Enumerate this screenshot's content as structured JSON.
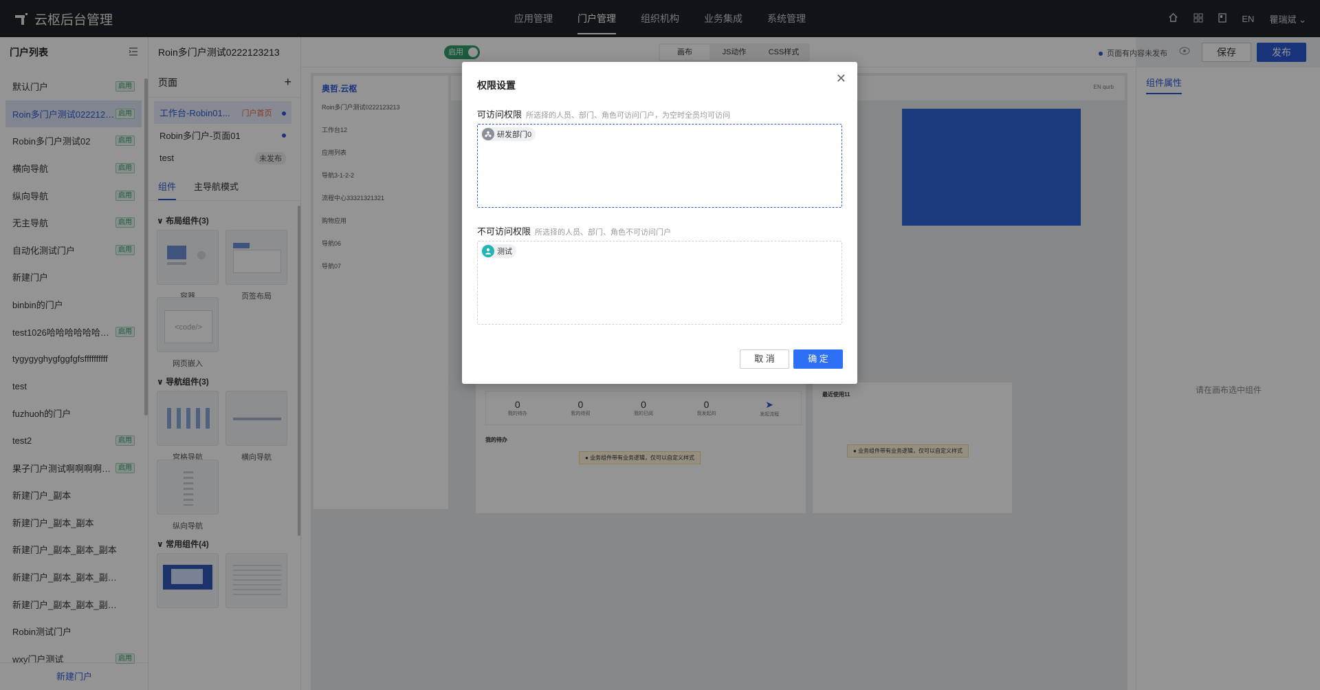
{
  "topbar": {
    "brand": "云枢后台管理",
    "nav": [
      "应用管理",
      "门户管理",
      "组织机构",
      "业务集成",
      "系统管理"
    ],
    "nav_active": 1,
    "lang": "EN",
    "user": "瞿瑞斌"
  },
  "sidebar": {
    "title": "门户列表",
    "items": [
      {
        "label": "默认门户",
        "badge": "启用"
      },
      {
        "label": "Roin多门户测试0222123213",
        "badge": "启用",
        "active": true
      },
      {
        "label": "Robin多门户测试02",
        "badge": "启用"
      },
      {
        "label": "横向导航",
        "badge": "启用"
      },
      {
        "label": "纵向导航",
        "badge": "启用"
      },
      {
        "label": "无主导航",
        "badge": "启用"
      },
      {
        "label": "自动化测试门户",
        "badge": "启用"
      },
      {
        "label": "新建门户",
        "badge": ""
      },
      {
        "label": "binbin的门户",
        "badge": ""
      },
      {
        "label": "test1026哈哈哈哈哈哈哈哈哈哈",
        "badge": "启用"
      },
      {
        "label": "tygygyghygfggfgfsffffffffff",
        "badge": ""
      },
      {
        "label": "test",
        "badge": ""
      },
      {
        "label": "fuzhuoh的门户",
        "badge": ""
      },
      {
        "label": "test2",
        "badge": "启用"
      },
      {
        "label": "果子门户测试啊啊啊啊啊啊",
        "badge": "启用"
      },
      {
        "label": "新建门户_副本",
        "badge": ""
      },
      {
        "label": "新建门户_副本_副本",
        "badge": ""
      },
      {
        "label": "新建门户_副本_副本_副本",
        "badge": ""
      },
      {
        "label": "新建门户_副本_副本_副本_副本",
        "badge": ""
      },
      {
        "label": "新建门户_副本_副本_副本_副本_",
        "badge": ""
      },
      {
        "label": "Robin测试门户",
        "badge": ""
      },
      {
        "label": "wxy门户测试",
        "badge": "启用"
      }
    ],
    "footer": "新建门户"
  },
  "pages": {
    "header": "页面",
    "items": [
      {
        "label": "工作台-Robin01...",
        "tag": "门户首页",
        "dot": true,
        "active": true
      },
      {
        "label": "Robin多门户-页面01",
        "tag": "",
        "dot": true
      },
      {
        "label": "test",
        "tag": "未发布",
        "dot": false
      }
    ],
    "tabs": [
      "组件",
      "主导航模式"
    ],
    "sections": {
      "layout": "布局组件(3)",
      "nav": "导航组件(3)",
      "common": "常用组件(4)"
    },
    "components": {
      "container": "容器",
      "tab_layout": "页签布局",
      "iframe": "网页嵌入",
      "code": "<code/>",
      "grid_nav": "宫格导航",
      "h_nav": "横向导航",
      "v_nav": "纵向导航"
    }
  },
  "editor": {
    "portal_name": "Roin多门户测试0222123213",
    "toggle": "启用",
    "tabs": [
      "画布",
      "JS动作",
      "CSS样式"
    ],
    "status": "页面有内容未发布",
    "save": "保存",
    "publish": "发布",
    "preview": {
      "logo": "奥哲.云枢",
      "portal": "Roin多门户测试0222123213",
      "menu": [
        "工作台12",
        "应用列表",
        "导航3-1-2-2",
        "流程中心33321321321",
        "购物应用",
        "导航06",
        "导航07"
      ],
      "stats": [
        {
          "num": "0",
          "label": "我的待办"
        },
        {
          "num": "0",
          "label": "我的待阅"
        },
        {
          "num": "0",
          "label": "我的已阅"
        },
        {
          "num": "0",
          "label": "我发起的"
        }
      ],
      "launch": "发起流程",
      "todo_title": "我的待办",
      "recent": "最近使用11",
      "notice": "业务组件带有业务逻辑，仅可以自定义样式",
      "top_right": "EN qurb"
    }
  },
  "props": {
    "title": "组件属性",
    "empty": "请在画布选中组件"
  },
  "modal": {
    "title": "权限设置",
    "allow_label": "可访问权限",
    "allow_hint": "所选择的人员、部门、角色可访问门户，为空时全员均可访问",
    "allow_chip": "研发部门0",
    "deny_label": "不可访问权限",
    "deny_hint": "所选择的人员、部门、角色不可访问门户",
    "deny_chip": "测试",
    "cancel": "取 消",
    "ok": "确 定",
    "colors": {
      "accent": "#2d6ff5",
      "chip_dept": "#8a8f99",
      "chip_user": "#21b5b5"
    }
  }
}
